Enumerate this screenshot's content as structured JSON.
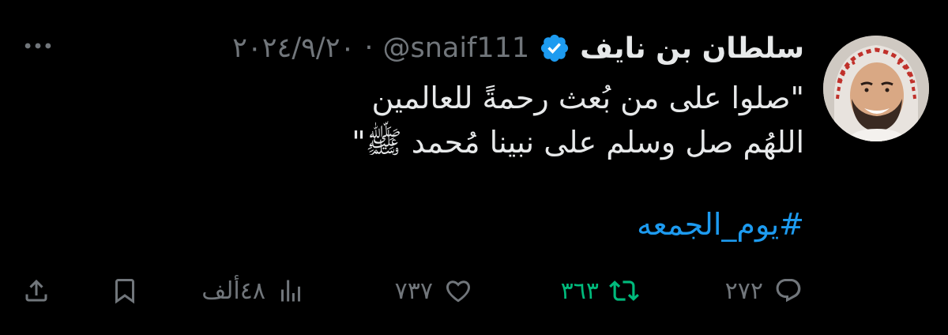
{
  "tweet": {
    "author": {
      "display_name": "سلطان بن نايف",
      "handle": "@snaif111",
      "verified": true
    },
    "separator": "·",
    "date": "٢٠٢٤/٩/٢٠",
    "text_lines": [
      "\"صلوا على من بُعث رحمةً للعالمين",
      "اللهُم صل وسلم على نبينا مُحمد ﷺ\""
    ],
    "hashtag": "#يوم_الجمعه",
    "actions": {
      "replies": "٢٧٢",
      "retweets": "٣٦٣",
      "likes": "٧٣٧",
      "views": "٤٨ألف"
    }
  },
  "icons": {
    "more": "more-horizontal-icon",
    "verified": "verified-badge-icon",
    "reply": "reply-icon",
    "retweet": "retweet-icon",
    "like": "heart-icon",
    "views": "views-chart-icon",
    "bookmark": "bookmark-icon",
    "share": "share-icon"
  },
  "colors": {
    "background": "#000000",
    "text": "#e7e9ea",
    "muted": "#71767b",
    "link": "#1d9bf0",
    "retweet": "#00ba7c",
    "verified": "#1d9bf0"
  }
}
